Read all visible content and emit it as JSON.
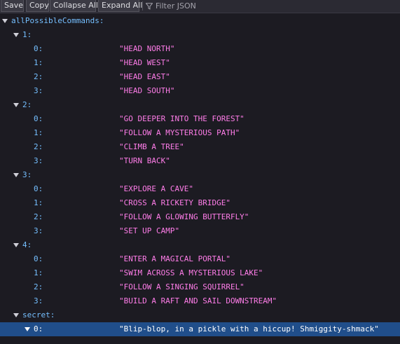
{
  "toolbar": {
    "save_label": "Save",
    "copy_label": "Copy",
    "collapse_label": "Collapse All",
    "expand_label": "Expand All",
    "filter_placeholder": "Filter JSON",
    "filter_icon": "funnel-icon"
  },
  "tree": {
    "root_key": "allPossibleCommands:",
    "groups": [
      {
        "key": "1:",
        "items": [
          {
            "key": "0:",
            "value": "\"HEAD NORTH\""
          },
          {
            "key": "1:",
            "value": "\"HEAD WEST\""
          },
          {
            "key": "2:",
            "value": "\"HEAD EAST\""
          },
          {
            "key": "3:",
            "value": "\"HEAD SOUTH\""
          }
        ]
      },
      {
        "key": "2:",
        "items": [
          {
            "key": "0:",
            "value": "\"GO DEEPER INTO THE FOREST\""
          },
          {
            "key": "1:",
            "value": "\"FOLLOW A MYSTERIOUS PATH\""
          },
          {
            "key": "2:",
            "value": "\"CLIMB A TREE\""
          },
          {
            "key": "3:",
            "value": "\"TURN BACK\""
          }
        ]
      },
      {
        "key": "3:",
        "items": [
          {
            "key": "0:",
            "value": "\"EXPLORE A CAVE\""
          },
          {
            "key": "1:",
            "value": "\"CROSS A RICKETY BRIDGE\""
          },
          {
            "key": "2:",
            "value": "\"FOLLOW A GLOWING BUTTERFLY\""
          },
          {
            "key": "3:",
            "value": "\"SET UP CAMP\""
          }
        ]
      },
      {
        "key": "4:",
        "items": [
          {
            "key": "0:",
            "value": "\"ENTER A MAGICAL PORTAL\""
          },
          {
            "key": "1:",
            "value": "\"SWIM ACROSS A MYSTERIOUS LAKE\""
          },
          {
            "key": "2:",
            "value": "\"FOLLOW A SINGING SQUIRREL\""
          },
          {
            "key": "3:",
            "value": "\"BUILD A RAFT AND SAIL DOWNSTREAM\""
          }
        ]
      }
    ],
    "secret": {
      "key": "secret:",
      "items": [
        {
          "key": "0:",
          "value": "\"Blip-blop, in a pickle with a hiccup! Shmiggity-shmack\""
        }
      ]
    }
  },
  "colors": {
    "background": "#1c1b22",
    "key": "#75bfff",
    "string_value": "#ff7de9",
    "selection": "#204e8a"
  }
}
